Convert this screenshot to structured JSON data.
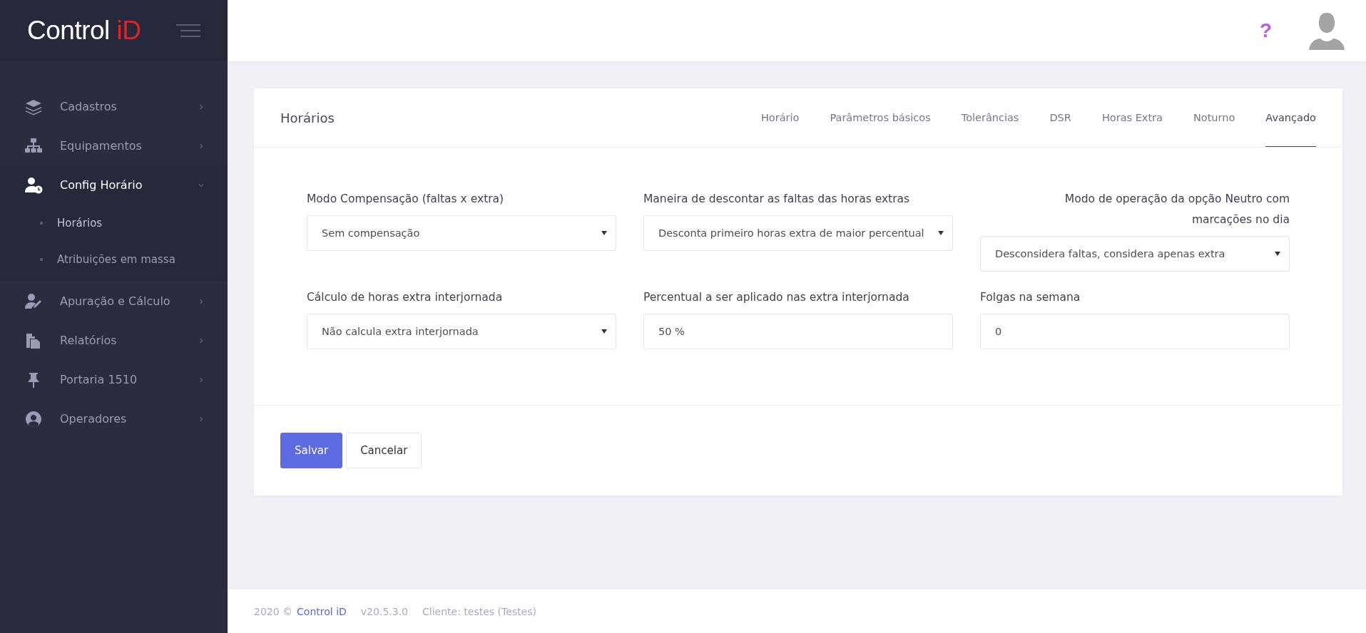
{
  "brand": {
    "name": "Control",
    "accent": "iD"
  },
  "sidebar": {
    "items": [
      {
        "label": "Cadastros",
        "active": false,
        "expanded": false
      },
      {
        "label": "Equipamentos",
        "active": false,
        "expanded": false
      },
      {
        "label": "Config Horário",
        "active": true,
        "expanded": true,
        "children": [
          {
            "label": "Horários",
            "selected": true
          },
          {
            "label": "Atribuições em massa",
            "selected": false
          }
        ]
      },
      {
        "label": "Apuração e Cálculo",
        "active": false,
        "expanded": false
      },
      {
        "label": "Relatórios",
        "active": false,
        "expanded": false
      },
      {
        "label": "Portaria 1510",
        "active": false,
        "expanded": false
      },
      {
        "label": "Operadores",
        "active": false,
        "expanded": false
      }
    ]
  },
  "header": {
    "help": "?"
  },
  "card": {
    "title": "Horários",
    "tabs": [
      {
        "label": "Horário",
        "selected": false
      },
      {
        "label": "Parâmetros básicos",
        "selected": false
      },
      {
        "label": "Tolerâncias",
        "selected": false
      },
      {
        "label": "DSR",
        "selected": false
      },
      {
        "label": "Horas Extra",
        "selected": false
      },
      {
        "label": "Noturno",
        "selected": false
      },
      {
        "label": "Avançado",
        "selected": true
      }
    ],
    "fields": [
      {
        "label": "Modo Compensação (faltas x extra)",
        "kind": "select",
        "value": "Sem compensação"
      },
      {
        "label": "Maneira de descontar as faltas das horas extras",
        "kind": "select",
        "value": "Desconta primeiro horas extra de maior percentual"
      },
      {
        "label": "Modo de operação da opção Neutro com marcações no dia",
        "kind": "select",
        "value": "Desconsidera faltas, considera apenas extra"
      },
      {
        "label": "Cálculo de horas extra interjornada",
        "kind": "select",
        "value": "Não calcula extra interjornada"
      },
      {
        "label": "Percentual a ser aplicado nas extra interjornada",
        "kind": "input",
        "value": "50 %"
      },
      {
        "label": "Folgas na semana",
        "kind": "input",
        "value": "0"
      }
    ],
    "buttons": [
      {
        "label": "Salvar",
        "kind": "primary"
      },
      {
        "label": "Cancelar",
        "kind": "secondary"
      }
    ]
  },
  "footer": {
    "year": "2020 ©",
    "link": "Control iD",
    "version": "v20.5.3.0",
    "client": "Cliente: testes (Testes)"
  }
}
